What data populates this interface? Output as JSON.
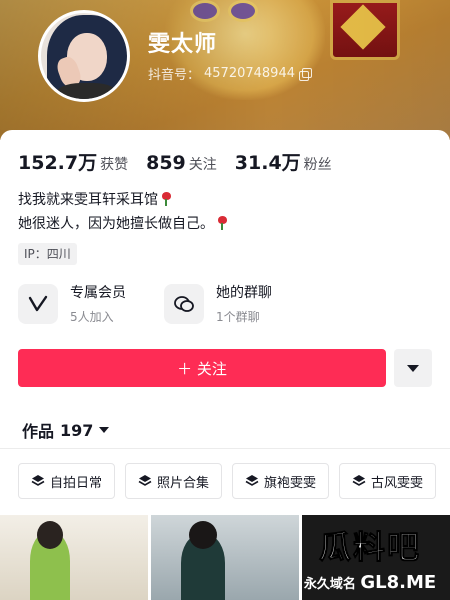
{
  "profile": {
    "name": "雯太师",
    "id_label": "抖音号：",
    "id_value": "45720748944"
  },
  "stats": [
    {
      "value": "152.7万",
      "label": "获赞"
    },
    {
      "value": "859",
      "label": "关注"
    },
    {
      "value": "31.4万",
      "label": "粉丝"
    }
  ],
  "bio": {
    "line1": "找我就来雯耳轩采耳馆",
    "line2": "她很迷人，因为她擅长做自己。"
  },
  "ip_tag": "IP：四川",
  "features": [
    {
      "title": "专属会员",
      "sub": "5人加入",
      "icon": "vip-icon"
    },
    {
      "title": "她的群聊",
      "sub": "1个群聊",
      "icon": "chat-icon"
    }
  ],
  "follow_button": "＋ 关注",
  "works": {
    "label": "作品",
    "count": "197"
  },
  "collections": [
    {
      "label": "自拍日常"
    },
    {
      "label": "照片合集"
    },
    {
      "label": "旗袍雯雯"
    },
    {
      "label": "古风雯雯"
    }
  ],
  "watermark": {
    "logo": "瓜料吧",
    "prefix": "永久域名",
    "domain": "GL8.ME"
  },
  "colors": {
    "accent": "#fe2c55",
    "text": "#161823",
    "muted": "#8a8b91"
  }
}
